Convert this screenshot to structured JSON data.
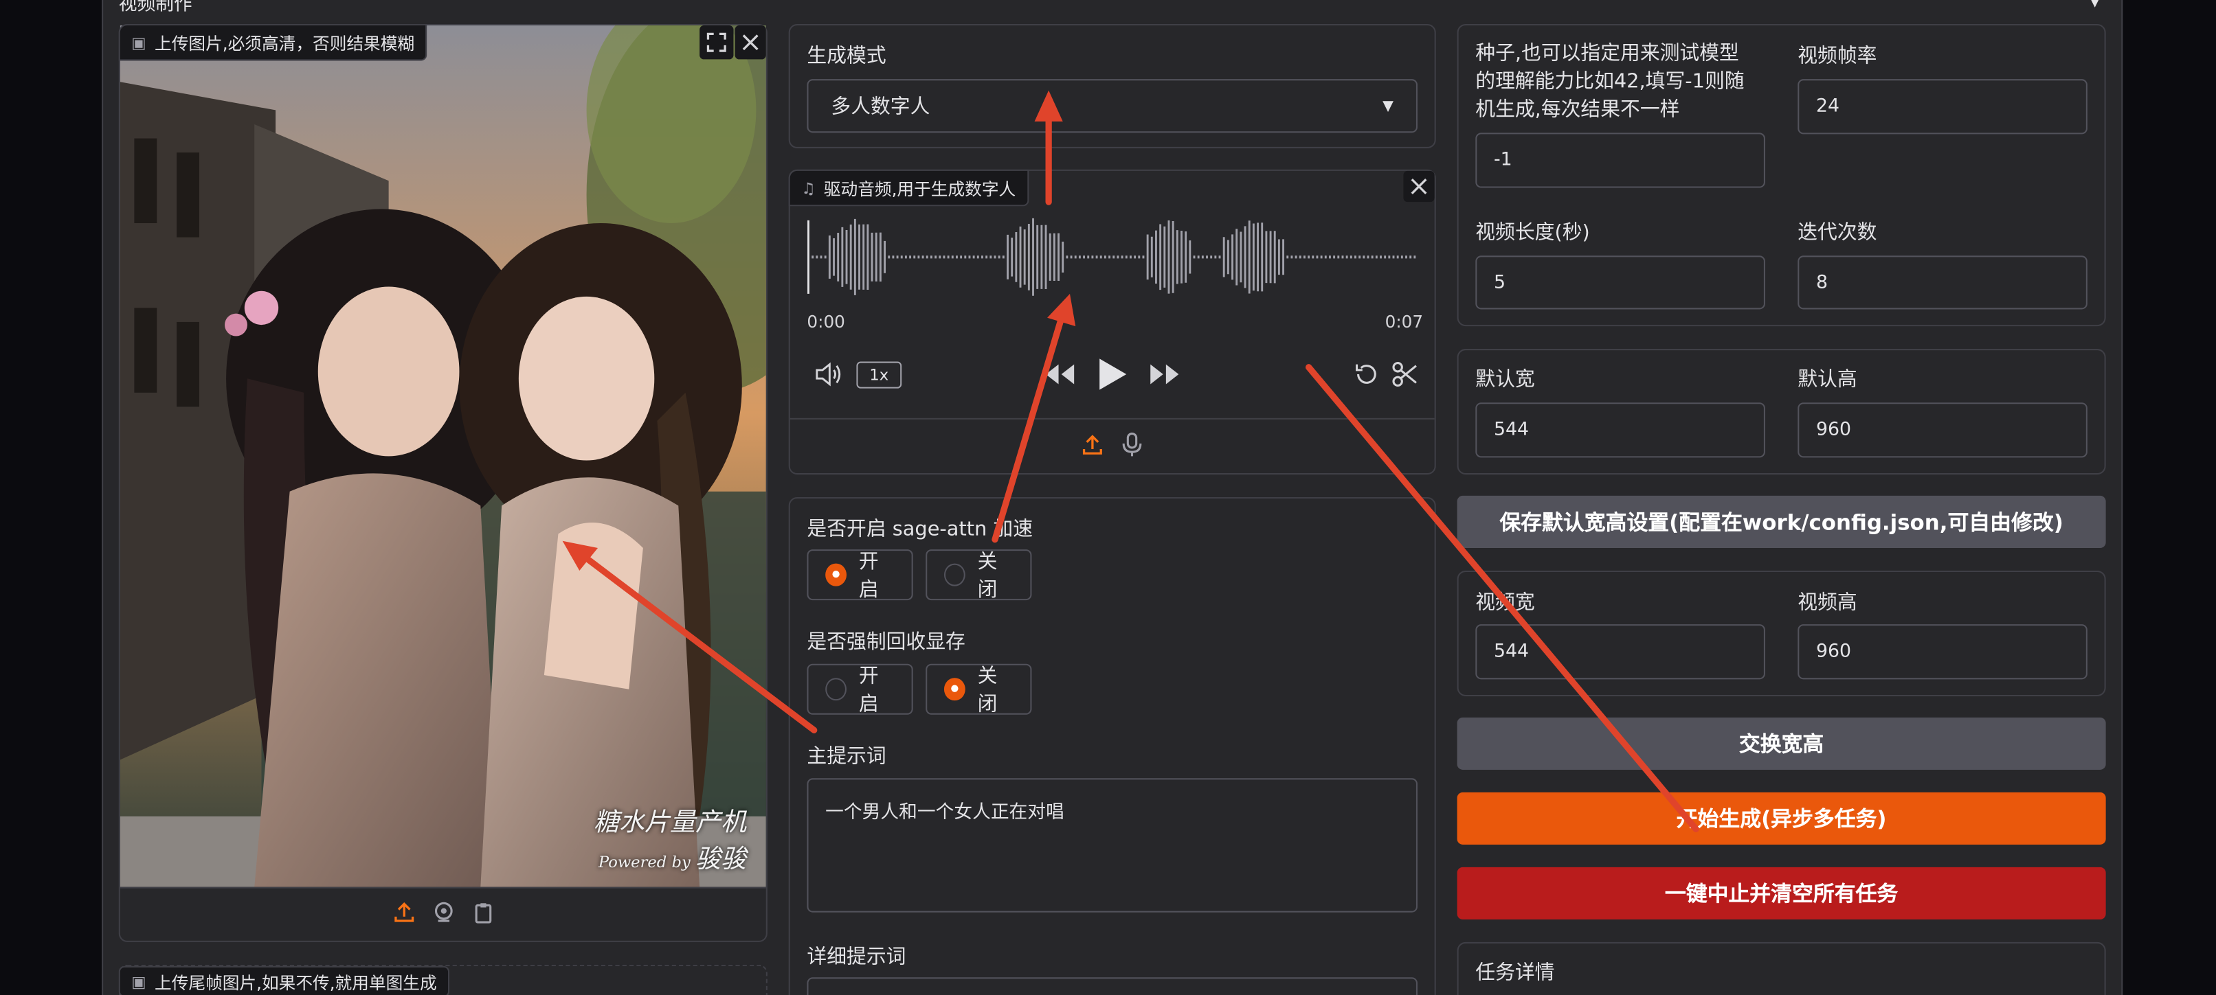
{
  "section": {
    "title": "视频制作"
  },
  "image_upload": {
    "label": "上传图片,必须高清，否则结果模糊",
    "watermark_line1": "糖水片量产机",
    "watermark_line2": "Powered by",
    "watermark_line3": "骏骏"
  },
  "tail_upload": {
    "label": "上传尾帧图片,如果不传,就用单图生成"
  },
  "mode": {
    "label": "生成模式",
    "value": "多人数字人"
  },
  "audio": {
    "label": "驱动音频,用于生成数字人",
    "time_start": "0:00",
    "time_end": "0:07",
    "speed": "1x"
  },
  "sage": {
    "label": "是否开启 sage-attn 加速",
    "opt_on": "开启",
    "opt_off": "关闭",
    "selected": "开启"
  },
  "gc": {
    "label": "是否强制回收显存",
    "opt_on": "开启",
    "opt_off": "关闭",
    "selected": "关闭"
  },
  "prompt": {
    "label": "主提示词",
    "value": "一个男人和一个女人正在对唱"
  },
  "detail_prompt": {
    "label": "详细提示词"
  },
  "seed": {
    "label": "种子,也可以指定用来测试模型的理解能力比如42,填写-1则随机生成,每次结果不一样",
    "value": "-1"
  },
  "fps": {
    "label": "视频帧率",
    "value": "24"
  },
  "duration": {
    "label": "视频长度(秒)",
    "value": "5"
  },
  "steps": {
    "label": "迭代次数",
    "value": "8"
  },
  "default_w": {
    "label": "默认宽",
    "value": "544"
  },
  "default_h": {
    "label": "默认高",
    "value": "960"
  },
  "save_btn": {
    "label": "保存默认宽高设置(配置在work/config.json,可自由修改)"
  },
  "video_w": {
    "label": "视频宽",
    "value": "544"
  },
  "video_h": {
    "label": "视频高",
    "value": "960"
  },
  "swap_btn": {
    "label": "交换宽高"
  },
  "start_btn": {
    "label": "开始生成(异步多任务)"
  },
  "stop_btn": {
    "label": "一键中止并清空所有任务"
  },
  "task": {
    "label": "任务详情"
  },
  "colors": {
    "accent": "#ea580c",
    "danger": "#b91c1c",
    "neutral_btn": "#52525b",
    "annotation": "#e0442b"
  }
}
